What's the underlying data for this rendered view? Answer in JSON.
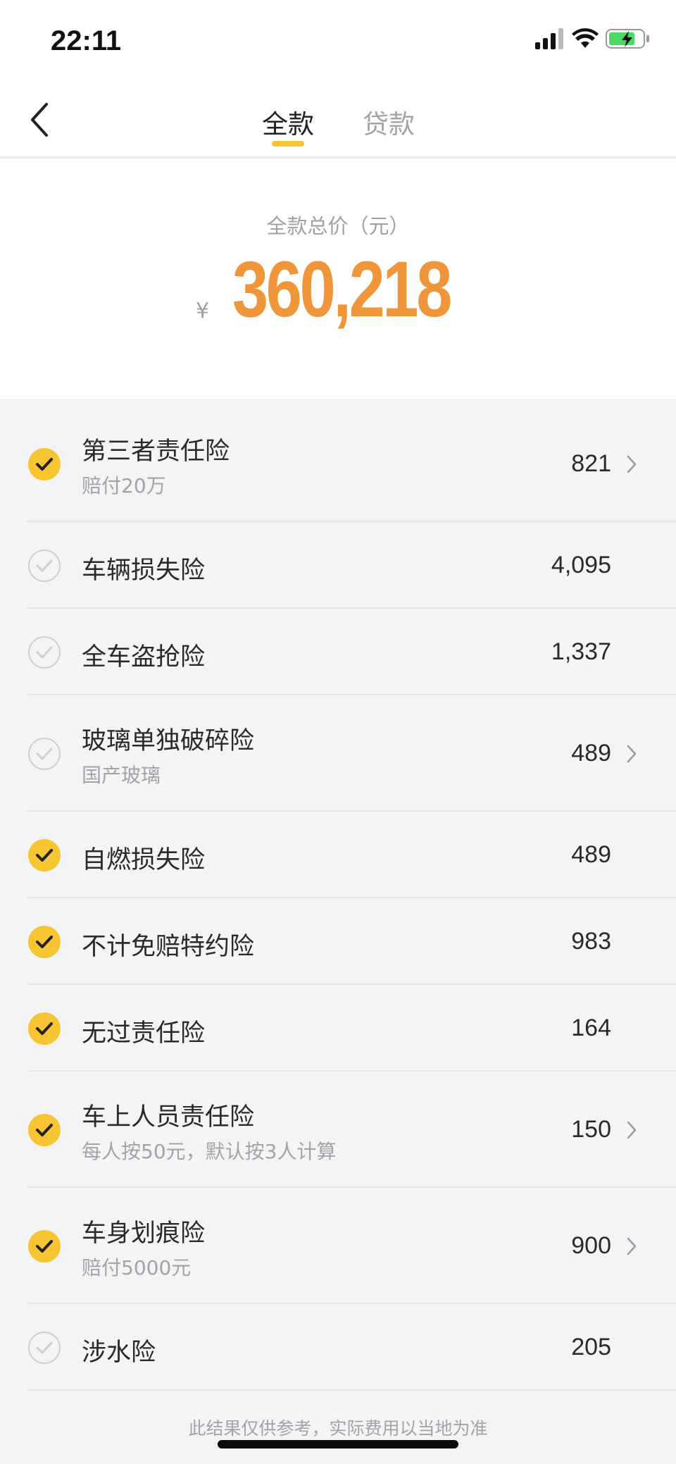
{
  "status_bar": {
    "time": "22:11",
    "icons": [
      "signal-icon",
      "wifi-icon",
      "battery-charging-icon"
    ]
  },
  "nav": {
    "back_icon": "chevron-left-icon",
    "tabs": [
      {
        "label": "全款",
        "selected": true
      },
      {
        "label": "贷款",
        "selected": false
      }
    ]
  },
  "total": {
    "label": "全款总价（元）",
    "currency": "¥",
    "amount": "360,218"
  },
  "items": [
    {
      "title": "第三者责任险",
      "subtitle": "赔付20万",
      "price": "821",
      "checked": true,
      "has_chevron": true
    },
    {
      "title": "车辆损失险",
      "subtitle": "",
      "price": "4,095",
      "checked": false,
      "has_chevron": false
    },
    {
      "title": "全车盗抢险",
      "subtitle": "",
      "price": "1,337",
      "checked": false,
      "has_chevron": false
    },
    {
      "title": "玻璃单独破碎险",
      "subtitle": "国产玻璃",
      "price": "489",
      "checked": false,
      "has_chevron": true
    },
    {
      "title": "自燃损失险",
      "subtitle": "",
      "price": "489",
      "checked": true,
      "has_chevron": false
    },
    {
      "title": "不计免赔特约险",
      "subtitle": "",
      "price": "983",
      "checked": true,
      "has_chevron": false
    },
    {
      "title": "无过责任险",
      "subtitle": "",
      "price": "164",
      "checked": true,
      "has_chevron": false
    },
    {
      "title": "车上人员责任险",
      "subtitle": "每人按50元，默认按3人计算",
      "price": "150",
      "checked": true,
      "has_chevron": true
    },
    {
      "title": "车身划痕险",
      "subtitle": "赔付5000元",
      "price": "900",
      "checked": true,
      "has_chevron": true
    },
    {
      "title": "涉水险",
      "subtitle": "",
      "price": "205",
      "checked": false,
      "has_chevron": false
    }
  ],
  "footer_note": "此结果仅供参考，实际费用以当地为准",
  "colors": {
    "accent": "#f7c531",
    "price": "#f0963a"
  }
}
